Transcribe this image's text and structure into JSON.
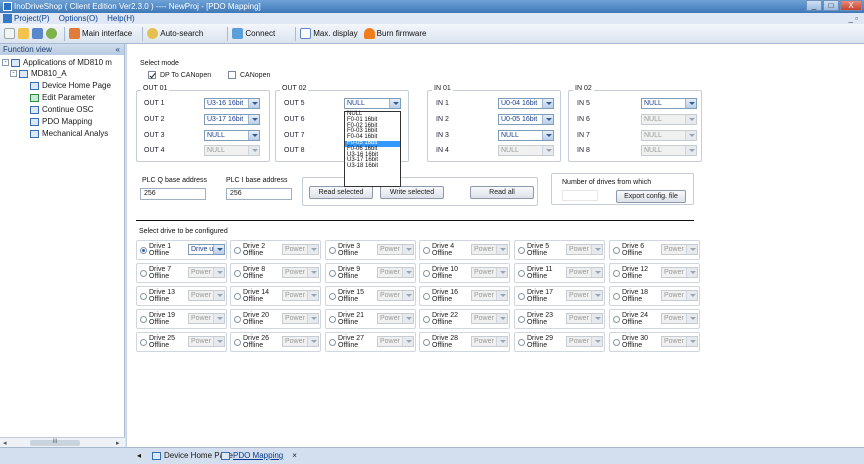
{
  "window": {
    "title": "InoDriveShop ( Client Edition Ver2.3.0 )  ----  NewProj - [PDO Mapping]",
    "buttons": [
      "_",
      "□",
      "X"
    ],
    "mdi_controls": "_ ▫"
  },
  "menu": [
    "Project(P)",
    "Options(O)",
    "Help(H)"
  ],
  "toolbar": {
    "main_interface": "Main interface",
    "auto_search": "Auto-search",
    "connect": "Connect",
    "max_display": "Max. display",
    "burn_firmware": "Burn firmware"
  },
  "sidebar": {
    "header": "Function view",
    "pin": "«",
    "root": "Applications of MD810 m",
    "node": "MD810_A",
    "items": [
      "Device Home Page",
      "Edit Parameter",
      "Continue OSC",
      "PDO Mapping",
      "Mechanical Analys"
    ]
  },
  "select_mode": {
    "label": "Select mode",
    "options": [
      {
        "label": "DP To CANopen",
        "checked": true
      },
      {
        "label": "CANopen",
        "checked": false
      }
    ]
  },
  "groups": {
    "out01": {
      "title": "OUT 01",
      "rows": [
        {
          "label": "OUT 1",
          "value": "U3-16 16bit",
          "enabled": true
        },
        {
          "label": "OUT 2",
          "value": "U3-17 16bit",
          "enabled": true
        },
        {
          "label": "OUT 3",
          "value": "NULL",
          "enabled": true
        },
        {
          "label": "OUT 4",
          "value": "NULL",
          "enabled": false
        }
      ]
    },
    "out02": {
      "title": "OUT 02",
      "rows": [
        {
          "label": "OUT 5",
          "value": "NULL",
          "enabled": true
        },
        {
          "label": "OUT 6",
          "value": "",
          "enabled": true
        },
        {
          "label": "OUT 7",
          "value": "",
          "enabled": true
        },
        {
          "label": "OUT 8",
          "value": "",
          "enabled": true
        }
      ]
    },
    "in01": {
      "title": "IN 01",
      "rows": [
        {
          "label": "IN 1",
          "value": "U0-04 16bit",
          "enabled": true
        },
        {
          "label": "IN 2",
          "value": "U0-05 16bit",
          "enabled": true
        },
        {
          "label": "IN 3",
          "value": "NULL",
          "enabled": true
        },
        {
          "label": "IN 4",
          "value": "NULL",
          "enabled": false
        }
      ]
    },
    "in02": {
      "title": "IN 02",
      "rows": [
        {
          "label": "IN 5",
          "value": "NULL",
          "enabled": true
        },
        {
          "label": "IN 6",
          "value": "NULL",
          "enabled": false
        },
        {
          "label": "IN 7",
          "value": "NULL",
          "enabled": false
        },
        {
          "label": "IN 8",
          "value": "NULL",
          "enabled": false
        }
      ]
    }
  },
  "dropdown": {
    "options": [
      "NULL",
      "F0-01 16bit",
      "F0-02 16bit",
      "F0-03 16bit",
      "F0-04 16bit",
      "F0-05 16bit",
      "F0-06 16bit",
      "U3-16 16bit",
      "U3-17 16bit",
      "U3-18 16bit"
    ],
    "selected_index": 5
  },
  "plc": {
    "q_label": "PLC Q base address",
    "q_value": "256",
    "i_label": "PLC I base address",
    "i_value": "256"
  },
  "actions": {
    "read_selected": "Read selected",
    "write_selected": "Write selected",
    "read_all": "Read all"
  },
  "drives_config": {
    "label": "Number of drives from which",
    "export": "Export config. file"
  },
  "drive_select_label": "Select drive to be configured",
  "drives": [
    {
      "name": "Drive 1",
      "status": "Offline",
      "combo": "Drive unit",
      "selected": true
    },
    {
      "name": "Drive 2",
      "status": "Offline",
      "combo": "Power u"
    },
    {
      "name": "Drive 3",
      "status": "Offline",
      "combo": "Power u"
    },
    {
      "name": "Drive 4",
      "status": "Offline",
      "combo": "Power u"
    },
    {
      "name": "Drive 5",
      "status": "Offline",
      "combo": "Power u"
    },
    {
      "name": "Drive 6",
      "status": "Offline",
      "combo": "Power u"
    },
    {
      "name": "Drive 7",
      "status": "Offline",
      "combo": "Power u"
    },
    {
      "name": "Drive 8",
      "status": "Offline",
      "combo": "Power u"
    },
    {
      "name": "Drive 9",
      "status": "Offline",
      "combo": "Power u"
    },
    {
      "name": "Drive 10",
      "status": "Offline",
      "combo": "Power u"
    },
    {
      "name": "Drive 11",
      "status": "Offline",
      "combo": "Power u"
    },
    {
      "name": "Drive 12",
      "status": "Offline",
      "combo": "Power u"
    },
    {
      "name": "Drive 13",
      "status": "Offline",
      "combo": "Power u"
    },
    {
      "name": "Drive 14",
      "status": "Offline",
      "combo": "Power u"
    },
    {
      "name": "Drive 15",
      "status": "Offline",
      "combo": "Power u"
    },
    {
      "name": "Drive 16",
      "status": "Offline",
      "combo": "Power u"
    },
    {
      "name": "Drive 17",
      "status": "Offline",
      "combo": "Power u"
    },
    {
      "name": "Drive 18",
      "status": "Offline",
      "combo": "Power u"
    },
    {
      "name": "Drive 19",
      "status": "Offline",
      "combo": "Power u"
    },
    {
      "name": "Drive 20",
      "status": "Offline",
      "combo": "Power u"
    },
    {
      "name": "Drive 21",
      "status": "Offline",
      "combo": "Power u"
    },
    {
      "name": "Drive 22",
      "status": "Offline",
      "combo": "Power u"
    },
    {
      "name": "Drive 23",
      "status": "Offline",
      "combo": "Power u"
    },
    {
      "name": "Drive 24",
      "status": "Offline",
      "combo": "Power u"
    },
    {
      "name": "Drive 25",
      "status": "Offline",
      "combo": "Power u"
    },
    {
      "name": "Drive 26",
      "status": "Offline",
      "combo": "Power u"
    },
    {
      "name": "Drive 27",
      "status": "Offline",
      "combo": "Power u"
    },
    {
      "name": "Drive 28",
      "status": "Offline",
      "combo": "Power u"
    },
    {
      "name": "Drive 29",
      "status": "Offline",
      "combo": "Power u"
    },
    {
      "name": "Drive 30",
      "status": "Offline",
      "combo": "Power u"
    }
  ],
  "tabs": {
    "nav_left": "◂",
    "tab1": "Device Home Page",
    "tab2": "PDO Mapping",
    "close": "×"
  },
  "sidebar_scroll": {
    "left": "◂",
    "right": "▸",
    "thumb": "III"
  },
  "colors": {
    "selection": "#3399ff",
    "accent": "#3e78b8"
  }
}
